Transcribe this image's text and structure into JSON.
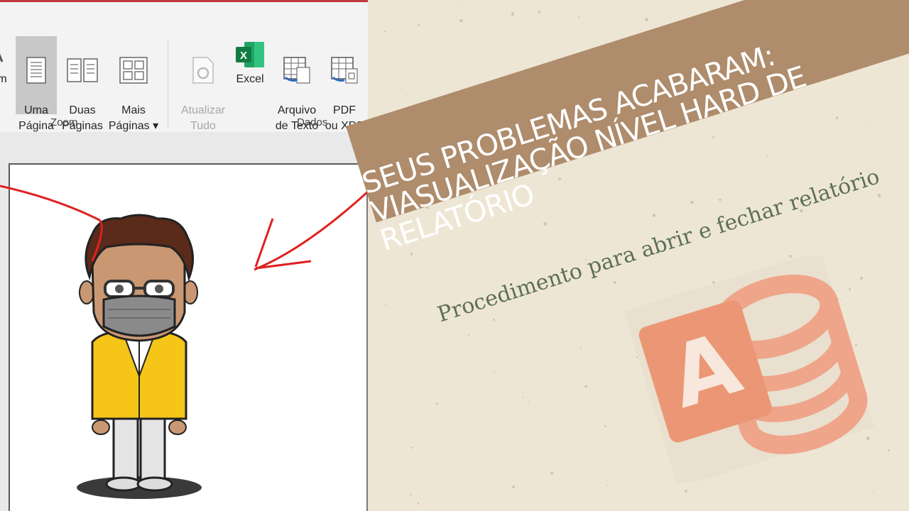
{
  "ribbon": {
    "buttons": {
      "zoom_partial": "m",
      "uma_pagina": "Uma\nPágina",
      "duas_paginas": "Duas\nPáginas",
      "mais_paginas": "Mais\nPáginas ▾",
      "atualizar_tudo": "Atualizar\nTudo",
      "excel": "Excel",
      "arquivo_texto": "Arquivo\nde Texto",
      "pdf_xps": "PDF\nou XPS"
    },
    "groups": {
      "zoom": "Zoom",
      "dados": "Dados"
    }
  },
  "banner": {
    "title": "SEUS PROBLEMAS ACABARAM:\nVIASUALIZAÇÃO NÍVEL HARD DE\nRELATÓRIO",
    "subtitle": "Procedimento para abrir e fechar relatório"
  },
  "logo": {
    "letter": "A",
    "name": "access-logo-icon"
  },
  "colors": {
    "banner": "#ae8c6c",
    "background": "#eee6d4",
    "subtitle": "#5c7058",
    "annotation": "#e02020",
    "jacket": "#f5c518",
    "logo": "#ec9a7a"
  }
}
